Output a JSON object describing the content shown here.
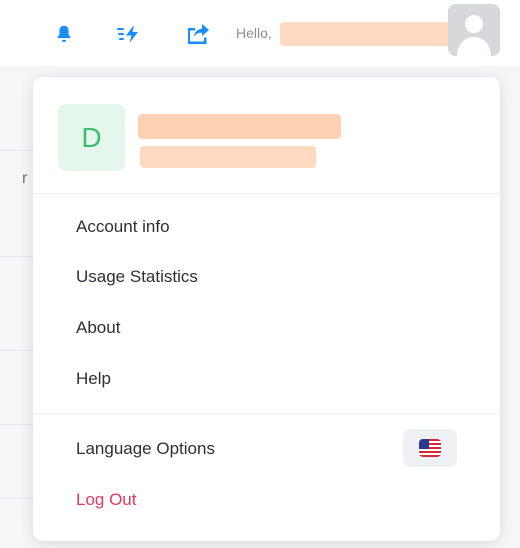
{
  "header": {
    "greeting": "Hello,",
    "icons": [
      "bell-icon",
      "bolt-icon",
      "share-icon",
      "avatar"
    ]
  },
  "profile": {
    "initial": "D"
  },
  "menu": {
    "items": [
      {
        "label": "Account info"
      },
      {
        "label": "Usage Statistics"
      },
      {
        "label": "About"
      },
      {
        "label": "Help"
      }
    ],
    "language_label": "Language Options",
    "logout_label": "Log Out"
  },
  "colors": {
    "accent": "#1a8cff",
    "logout": "#e5385f",
    "avatar_bg": "#e5f7ec",
    "avatar_text": "#3ebd6a"
  }
}
